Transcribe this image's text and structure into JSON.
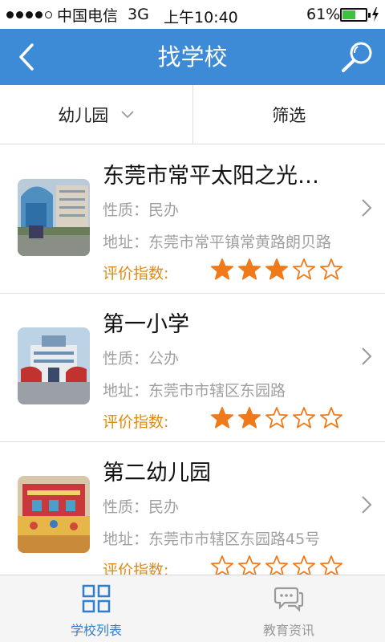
{
  "status_bar": {
    "carrier": "中国电信",
    "network": "3G",
    "time": "上午10:40",
    "battery": "61%",
    "battery_level": 0.61
  },
  "header": {
    "title": "找学校",
    "back_icon": "back-arrow-icon",
    "search_icon": "search-icon"
  },
  "filter_bar": {
    "category": "幼儿园",
    "filter": "筛选"
  },
  "schools": [
    {
      "name": "东莞市常平太阳之光…",
      "type": "性质：民办",
      "address": "地址：东莞市常平镇常黄路朗贝路",
      "rating_label": "评价指数:",
      "rating": 3
    },
    {
      "name": "第一小学",
      "type": "性质：公办",
      "address": "地址：东莞市市辖区东园路",
      "rating_label": "评价指数:",
      "rating": 2
    },
    {
      "name": "第二幼儿园",
      "type": "性质：民办",
      "address": "地址：东莞市市辖区东园路45号",
      "rating_label": "评价指数:",
      "rating": 0
    }
  ],
  "tabs": [
    {
      "label": "学校列表",
      "icon": "grid-icon",
      "active": true
    },
    {
      "label": "教育资讯",
      "icon": "chat-bubble-icon",
      "active": false
    }
  ],
  "colors": {
    "accent": "#3d8ad6",
    "star": "#f07a1a",
    "rating_label": "#e08a12",
    "active_tab": "#2f7fd0"
  }
}
